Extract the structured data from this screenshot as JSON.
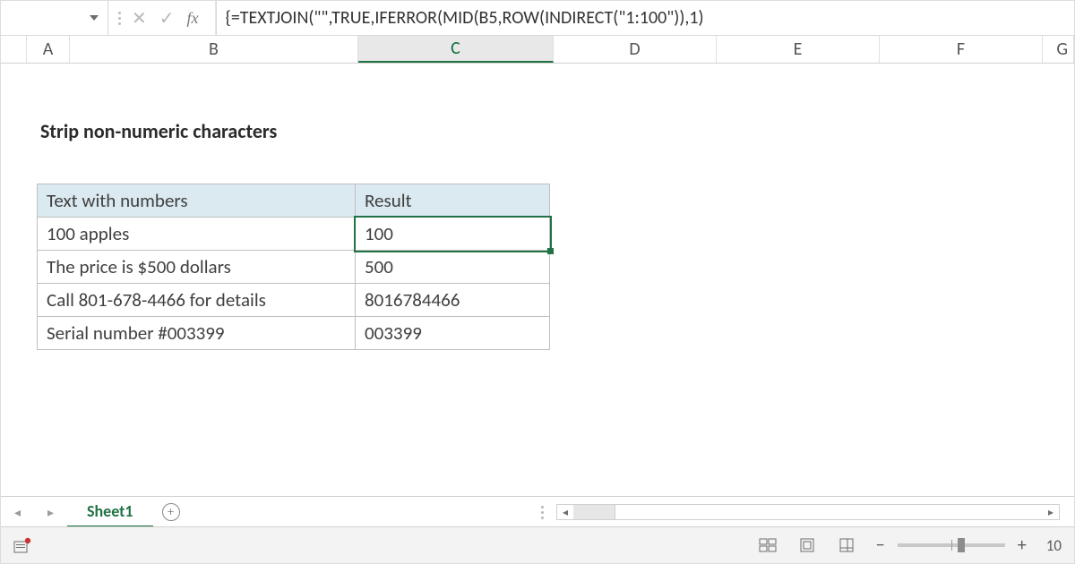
{
  "formula_bar": {
    "fx_label": "fx",
    "formula": "{=TEXTJOIN(\"\",TRUE,IFERROR(MID(B5,ROW(INDIRECT(\"1:100\")),1)"
  },
  "columns": {
    "a": "A",
    "b": "B",
    "c": "C",
    "d": "D",
    "e": "E",
    "f": "F",
    "g": "G"
  },
  "title": "Strip non-numeric characters",
  "table": {
    "headers": {
      "b": "Text with numbers",
      "c": "Result"
    },
    "rows": [
      {
        "b": "100 apples",
        "c": "100"
      },
      {
        "b": "The price is $500 dollars",
        "c": "500"
      },
      {
        "b": "Call 801-678-4466 for details",
        "c": "8016784466"
      },
      {
        "b": "Serial number #003399",
        "c": "003399"
      }
    ]
  },
  "sheet_tab": "Sheet1",
  "zoom_label": "10"
}
